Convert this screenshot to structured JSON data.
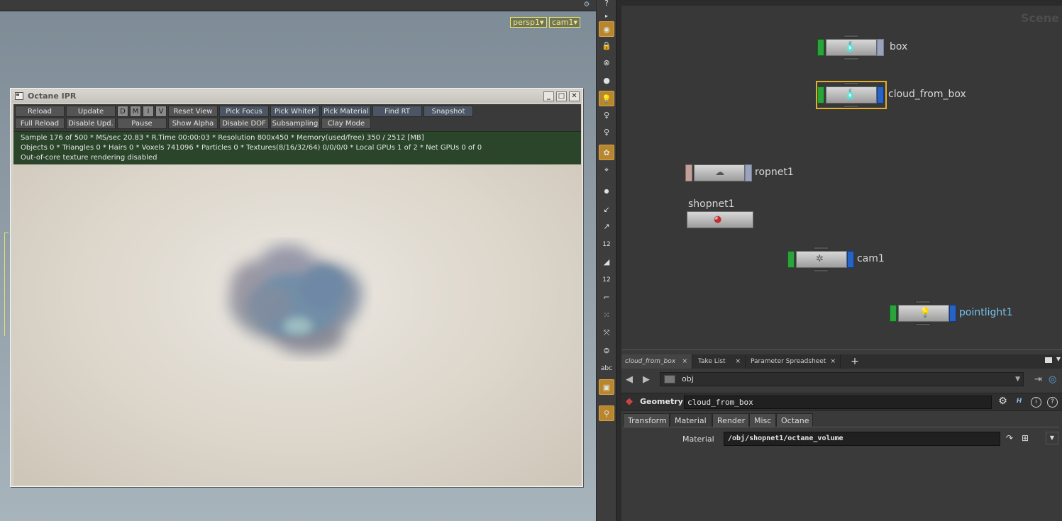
{
  "viewport": {
    "camera_persp": "persp1▾",
    "camera_cam": "cam1▾"
  },
  "ipr": {
    "title": "Octane IPR",
    "toolbar_row1": [
      "Reload",
      "Update",
      "D",
      "M",
      "I",
      "V",
      "Reset View",
      "Pick Focus",
      "Pick WhiteP",
      "Pick Material",
      "Find RT",
      "Snapshot"
    ],
    "toolbar_row2": [
      "Full Reload",
      "Disable Upd.",
      "Pause",
      "Show Alpha",
      "Disable DOF",
      "Subsampling",
      "Clay Mode"
    ],
    "status_line1": "Sample 176 of 500 * MS/sec 20.83 * R.Time 00:00:03 * Resolution 800x450 * Memory(used/free) 350 / 2512 [MB]",
    "status_line2": "Objects 0 * Triangles 0 * Hairs 0 * Voxels 741096 * Particles 0 * Textures(8/16/32/64) 0/0/0/0 * Local GPUs 1 of 2 * Net GPUs 0 of 0",
    "status_line3": "Out-of-core texture rendering disabled"
  },
  "shelf": {
    "icons": [
      "eye-icon",
      "lock-icon",
      "snap-icon",
      "sphere-icon",
      "light-bulb-icon",
      "spot-light-icon",
      "point-light-icon",
      "render-icon",
      "camera-icon",
      "dot-icon",
      "brush-icon",
      "pen-icon",
      "number-icon",
      "paint-icon",
      "paint-number-icon",
      "curve-icon",
      "grid-icon",
      "axis-icon",
      "circle-icon",
      "text-icon",
      "image-icon",
      "pin-icon"
    ],
    "text_label": "abc",
    "number_label": "12"
  },
  "network": {
    "watermark": "Scene",
    "nodes": [
      {
        "label": "box"
      },
      {
        "label": "cloud_from_box"
      },
      {
        "label": "ropnet1"
      },
      {
        "label": "shopnet1"
      },
      {
        "label": "cam1"
      },
      {
        "label": "pointlight1"
      }
    ]
  },
  "panel": {
    "tabs": [
      "cloud_from_box",
      "Take List",
      "Parameter Spreadsheet"
    ],
    "path": "obj",
    "node_type": "Geometry",
    "node_name": "cloud_from_box",
    "param_tabs": [
      "Transform",
      "Material",
      "Render",
      "Misc",
      "Octane"
    ],
    "material_label": "Material",
    "material_value": "/obj/shopnet1/octane_volume"
  },
  "colors": {
    "active_shelf": "#b8872d",
    "selection": "#e3b02a",
    "display_flag": "#2aa33b",
    "render_flag": "#2763c4",
    "status_bg": "#2a452a"
  }
}
